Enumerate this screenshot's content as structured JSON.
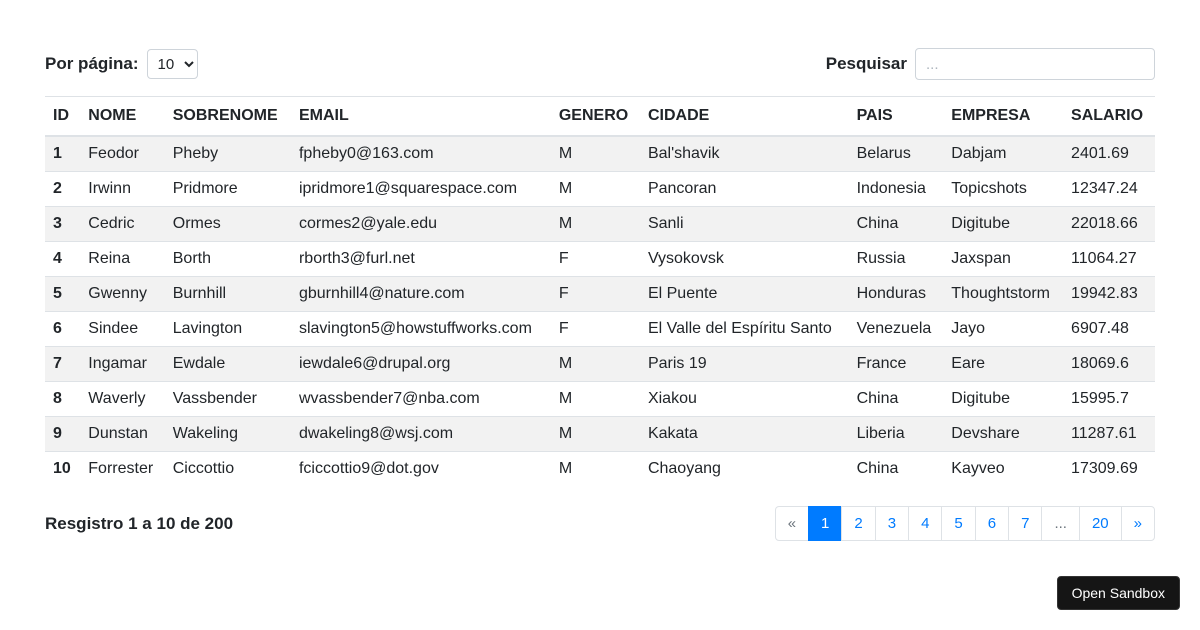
{
  "controls": {
    "per_page_label": "Por página:",
    "per_page_value": "10",
    "search_label": "Pesquisar",
    "search_placeholder": "..."
  },
  "columns": {
    "id": "ID",
    "nome": "NOME",
    "sobrenome": "SOBRENOME",
    "email": "EMAIL",
    "genero": "GENERO",
    "cidade": "CIDADE",
    "pais": "PAIS",
    "empresa": "EMPRESA",
    "salario": "SALARIO"
  },
  "rows": [
    {
      "id": "1",
      "nome": "Feodor",
      "sobrenome": "Pheby",
      "email": "fpheby0@163.com",
      "genero": "M",
      "cidade": "Bal'shavik",
      "pais": "Belarus",
      "empresa": "Dabjam",
      "salario": "2401.69"
    },
    {
      "id": "2",
      "nome": "Irwinn",
      "sobrenome": "Pridmore",
      "email": "ipridmore1@squarespace.com",
      "genero": "M",
      "cidade": "Pancoran",
      "pais": "Indonesia",
      "empresa": "Topicshots",
      "salario": "12347.24"
    },
    {
      "id": "3",
      "nome": "Cedric",
      "sobrenome": "Ormes",
      "email": "cormes2@yale.edu",
      "genero": "M",
      "cidade": "Sanli",
      "pais": "China",
      "empresa": "Digitube",
      "salario": "22018.66"
    },
    {
      "id": "4",
      "nome": "Reina",
      "sobrenome": "Borth",
      "email": "rborth3@furl.net",
      "genero": "F",
      "cidade": "Vysokovsk",
      "pais": "Russia",
      "empresa": "Jaxspan",
      "salario": "11064.27"
    },
    {
      "id": "5",
      "nome": "Gwenny",
      "sobrenome": "Burnhill",
      "email": "gburnhill4@nature.com",
      "genero": "F",
      "cidade": "El Puente",
      "pais": "Honduras",
      "empresa": "Thoughtstorm",
      "salario": "19942.83"
    },
    {
      "id": "6",
      "nome": "Sindee",
      "sobrenome": "Lavington",
      "email": "slavington5@howstuffworks.com",
      "genero": "F",
      "cidade": "El Valle del Espíritu Santo",
      "pais": "Venezuela",
      "empresa": "Jayo",
      "salario": "6907.48"
    },
    {
      "id": "7",
      "nome": "Ingamar",
      "sobrenome": "Ewdale",
      "email": "iewdale6@drupal.org",
      "genero": "M",
      "cidade": "Paris 19",
      "pais": "France",
      "empresa": "Eare",
      "salario": "18069.6"
    },
    {
      "id": "8",
      "nome": "Waverly",
      "sobrenome": "Vassbender",
      "email": "wvassbender7@nba.com",
      "genero": "M",
      "cidade": "Xiakou",
      "pais": "China",
      "empresa": "Digitube",
      "salario": "15995.7"
    },
    {
      "id": "9",
      "nome": "Dunstan",
      "sobrenome": "Wakeling",
      "email": "dwakeling8@wsj.com",
      "genero": "M",
      "cidade": "Kakata",
      "pais": "Liberia",
      "empresa": "Devshare",
      "salario": "11287.61"
    },
    {
      "id": "10",
      "nome": "Forrester",
      "sobrenome": "Ciccottio",
      "email": "fciccottio9@dot.gov",
      "genero": "M",
      "cidade": "Chaoyang",
      "pais": "China",
      "empresa": "Kayveo",
      "salario": "17309.69"
    }
  ],
  "footer": {
    "record_text": "Resgistro 1 a 10 de 200"
  },
  "pagination": {
    "prev": "«",
    "next": "»",
    "ellipsis": "...",
    "pages": [
      "1",
      "2",
      "3",
      "4",
      "5",
      "6",
      "7"
    ],
    "last": "20",
    "active_index": 0
  },
  "sandbox": {
    "label": "Open Sandbox"
  }
}
